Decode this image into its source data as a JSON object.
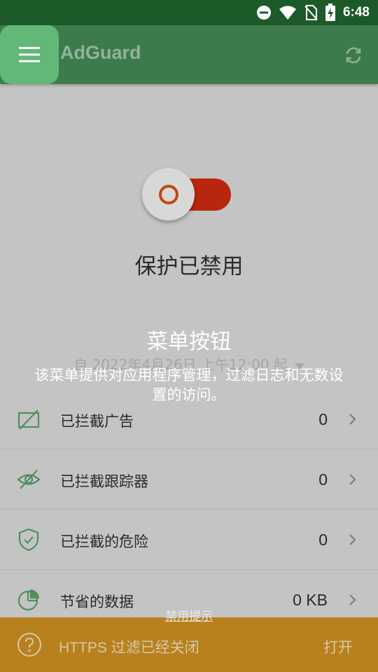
{
  "status_bar": {
    "time": "6:48",
    "icons": [
      "do-not-disturb-icon",
      "wifi-icon",
      "no-sim-icon",
      "battery-charging-icon"
    ]
  },
  "app_bar": {
    "title": "AdGuard",
    "menu_icon": "hamburger-menu-icon",
    "refresh_icon": "refresh-icon",
    "colors": {
      "bar": "#3d7a4c",
      "menu_highlight": "#61b877"
    }
  },
  "protection": {
    "toggle_on": false,
    "status_text": "保护已禁用",
    "since_text": "自 2022年4月26日 上午12:00 起",
    "colors": {
      "track": "#b8270d",
      "ring": "#c2470e"
    }
  },
  "hint": {
    "title": "菜单按钮",
    "description": "该菜单提供对应用程序管理，过滤日志和无数设置的访问。"
  },
  "stats": [
    {
      "label": "已拦截广告",
      "value": "0",
      "icon": "ad-blocked-icon"
    },
    {
      "label": "已拦截跟踪器",
      "value": "0",
      "icon": "tracker-blocked-icon"
    },
    {
      "label": "已拦截的危险",
      "value": "0",
      "icon": "shield-check-icon"
    },
    {
      "label": "节省的数据",
      "value": "0 KB",
      "icon": "pie-chart-icon"
    }
  ],
  "disable_hint_link": "禁用提示",
  "https_banner": {
    "text": "HTTPS 过滤已经关闭",
    "action": "打开",
    "icon": "help-circle-icon",
    "color": "#b8811d"
  }
}
